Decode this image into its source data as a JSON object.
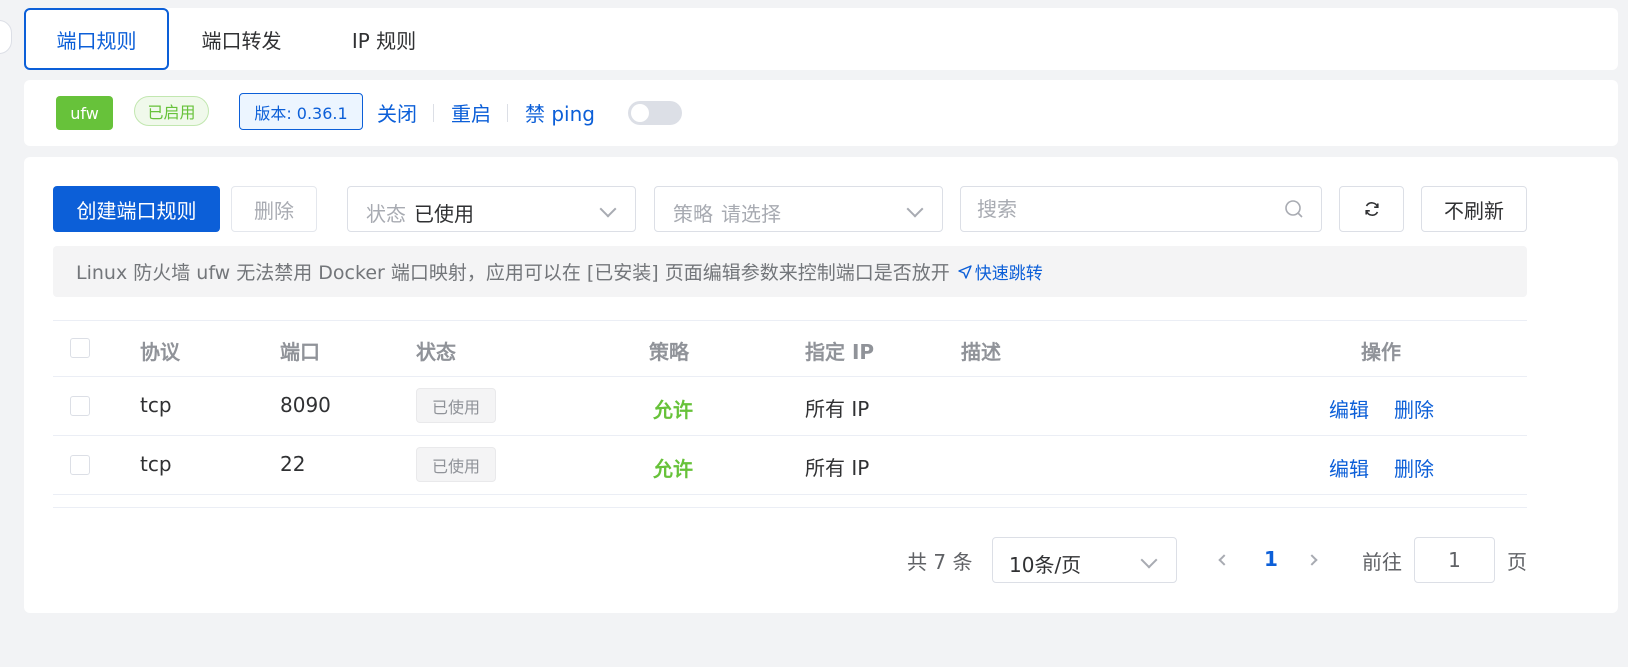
{
  "tabs": [
    {
      "label": "端口规则",
      "active": true
    },
    {
      "label": "端口转发",
      "active": false
    },
    {
      "label": "IP 规则",
      "active": false
    }
  ],
  "status_bar": {
    "firewall_name": "ufw",
    "state": "已启用",
    "version": "版本: 0.36.1",
    "close_label": "关闭",
    "restart_label": "重启",
    "ping_label": "禁 ping",
    "ping_disabled_on": false
  },
  "toolbar": {
    "create_label": "创建端口规则",
    "delete_label": "删除",
    "status_prefix": "状态",
    "status_value": "已使用",
    "policy_prefix": "策略",
    "policy_placeholder": "请选择",
    "search_placeholder": "搜索",
    "no_refresh_label": "不刷新"
  },
  "notice": {
    "text": "Linux 防火墙 ufw 无法禁用 Docker 端口映射，应用可以在 [已安装] 页面编辑参数来控制端口是否放开",
    "link_label": "快速跳转"
  },
  "table": {
    "headers": {
      "protocol": "协议",
      "port": "端口",
      "status": "状态",
      "policy": "策略",
      "ip": "指定 IP",
      "description": "描述",
      "actions": "操作"
    },
    "rows": [
      {
        "protocol": "tcp",
        "port": "8090",
        "status": "已使用",
        "policy": "允许",
        "ip": "所有 IP",
        "description": "",
        "edit": "编辑",
        "delete": "删除"
      },
      {
        "protocol": "tcp",
        "port": "22",
        "status": "已使用",
        "policy": "允许",
        "ip": "所有 IP",
        "description": "",
        "edit": "编辑",
        "delete": "删除"
      }
    ]
  },
  "pagination": {
    "total_text": "共 7 条",
    "page_size": "10条/页",
    "current_page": "1",
    "goto_label": "前往",
    "goto_value": "1",
    "page_suffix": "页"
  },
  "colors": {
    "primary": "#0c5fd8",
    "success": "#67c23a",
    "background": "#f2f3f5"
  }
}
